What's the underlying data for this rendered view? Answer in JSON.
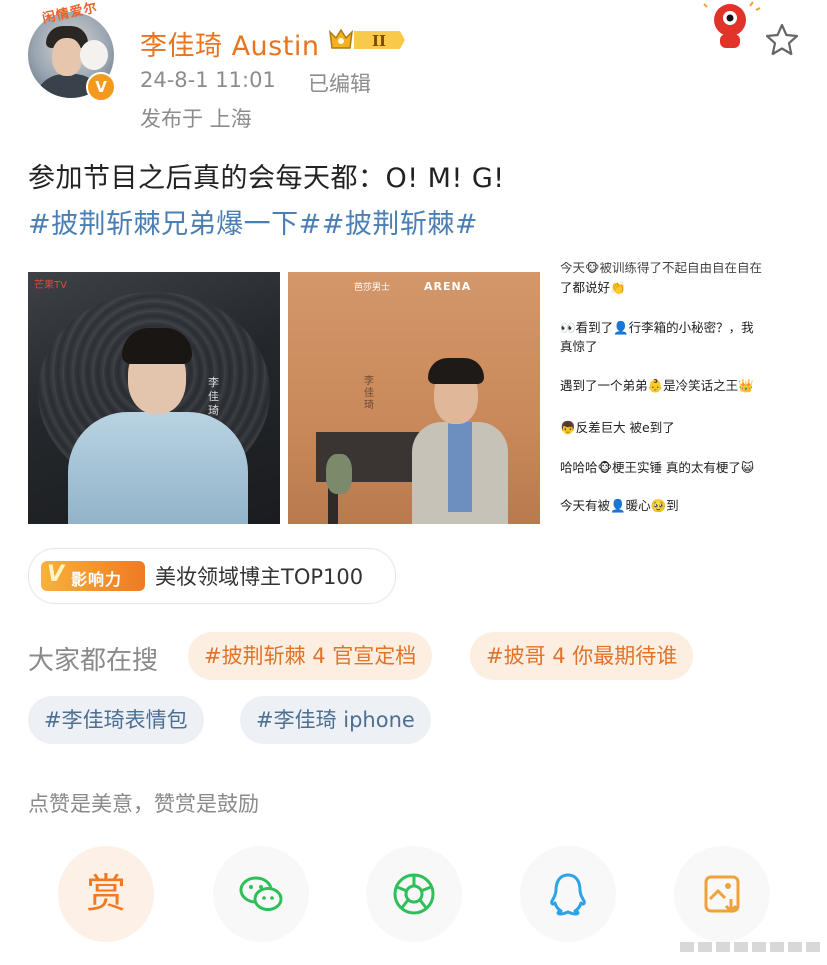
{
  "header": {
    "avatar_tag": "闲情爱尔",
    "username": "李佳琦 Austin",
    "badge_level": "II",
    "timestamp": "24-8-1 11:01",
    "edited": "已编辑",
    "location": "发布于 上海",
    "verified_mark": "V"
  },
  "post": {
    "text": "参加节目之后真的会每天都：O! M! G!",
    "hashtags": "#披荆斩棘兄弟爆一下##披荆斩棘#",
    "images": [
      {
        "logo": "芒果TV",
        "vertical_name": "李佳琦"
      },
      {
        "brand_a": "芭莎男士",
        "brand_b": "ARENA",
        "vertical_name": "李佳琦"
      },
      {
        "lines": [
          "今天🐵被训练得了不起自由自在自在",
          "了都说好👏",
          "👀看到了👤行李箱的小秘密？，我",
          "真惊了",
          "遇到了一个弟弟👶是冷笑话之王👑",
          "👦反差巨大 被e到了",
          "哈哈哈🐵梗王实锤 真的太有梗了😺",
          "今天有被👤暖心🥹到"
        ]
      }
    ]
  },
  "influence": {
    "logo_v": "V",
    "logo_text": "影响力",
    "label": "美妆领域博主TOP100"
  },
  "search": {
    "label": "大家都在搜",
    "pills": [
      {
        "text": "#披荆斩棘 4 官宣定档",
        "kind": "hot"
      },
      {
        "text": "#披哥 4 你最期待谁",
        "kind": "hot"
      },
      {
        "text": "#李佳琦表情包",
        "kind": "blue"
      },
      {
        "text": "#李佳琦 iphone",
        "kind": "blue"
      }
    ]
  },
  "slogan": "点赞是美意，赞赏是鼓励",
  "share": {
    "reward_label": "赏",
    "icons": [
      "reward-icon",
      "wechat-icon",
      "moments-icon",
      "qq-icon",
      "save-image-icon"
    ]
  },
  "colors": {
    "username": "#e8741f",
    "hashtag": "#4a7fb5",
    "hot_pill_bg": "#fdeee2",
    "hot_pill_text": "#e0742a",
    "blue_pill_bg": "#edf1f6",
    "blue_pill_text": "#4d6f92",
    "wechat": "#2fbf5a",
    "qq": "#2aa4e6",
    "save": "#f0a23a"
  }
}
